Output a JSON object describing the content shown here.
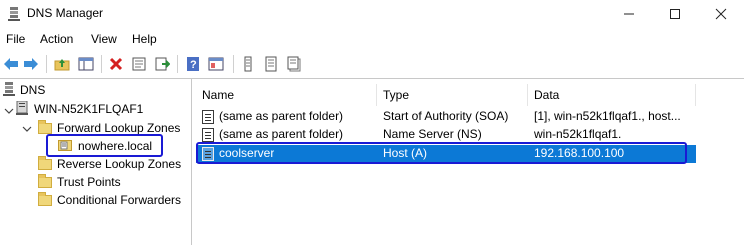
{
  "window": {
    "title": "DNS Manager",
    "controls": {
      "minimize": "—",
      "maximize": "☐",
      "close": "✕"
    }
  },
  "menu": {
    "items": [
      "File",
      "Action",
      "View",
      "Help"
    ]
  },
  "toolbar": {
    "buttons": [
      "back-icon",
      "forward-icon",
      "up-folder-icon",
      "show-hide-tree-icon",
      "delete-icon",
      "properties-icon",
      "export-list-icon",
      "help-icon",
      "view-icon",
      "record-icon-1",
      "record-icon-2",
      "record-icon-3"
    ],
    "accent": "#1a1ad4"
  },
  "tree": {
    "root": "DNS",
    "server": "WIN-N52K1FLQAF1",
    "forward_zones": "Forward Lookup Zones",
    "selected_zone": "nowhere.local",
    "reverse_zones": "Reverse Lookup Zones",
    "trust_points": "Trust Points",
    "conditional_forwarders": "Conditional Forwarders"
  },
  "list": {
    "columns": [
      "Name",
      "Type",
      "Data"
    ],
    "rows": [
      {
        "name": "(same as parent folder)",
        "type": "Start of Authority (SOA)",
        "data": "[1], win-n52k1flqaf1., host..."
      },
      {
        "name": "(same as parent folder)",
        "type": "Name Server (NS)",
        "data": "win-n52k1flqaf1."
      },
      {
        "name": "coolserver",
        "type": "Host (A)",
        "data": "192.168.100.100"
      }
    ],
    "selected_color": "#0c79d6"
  }
}
